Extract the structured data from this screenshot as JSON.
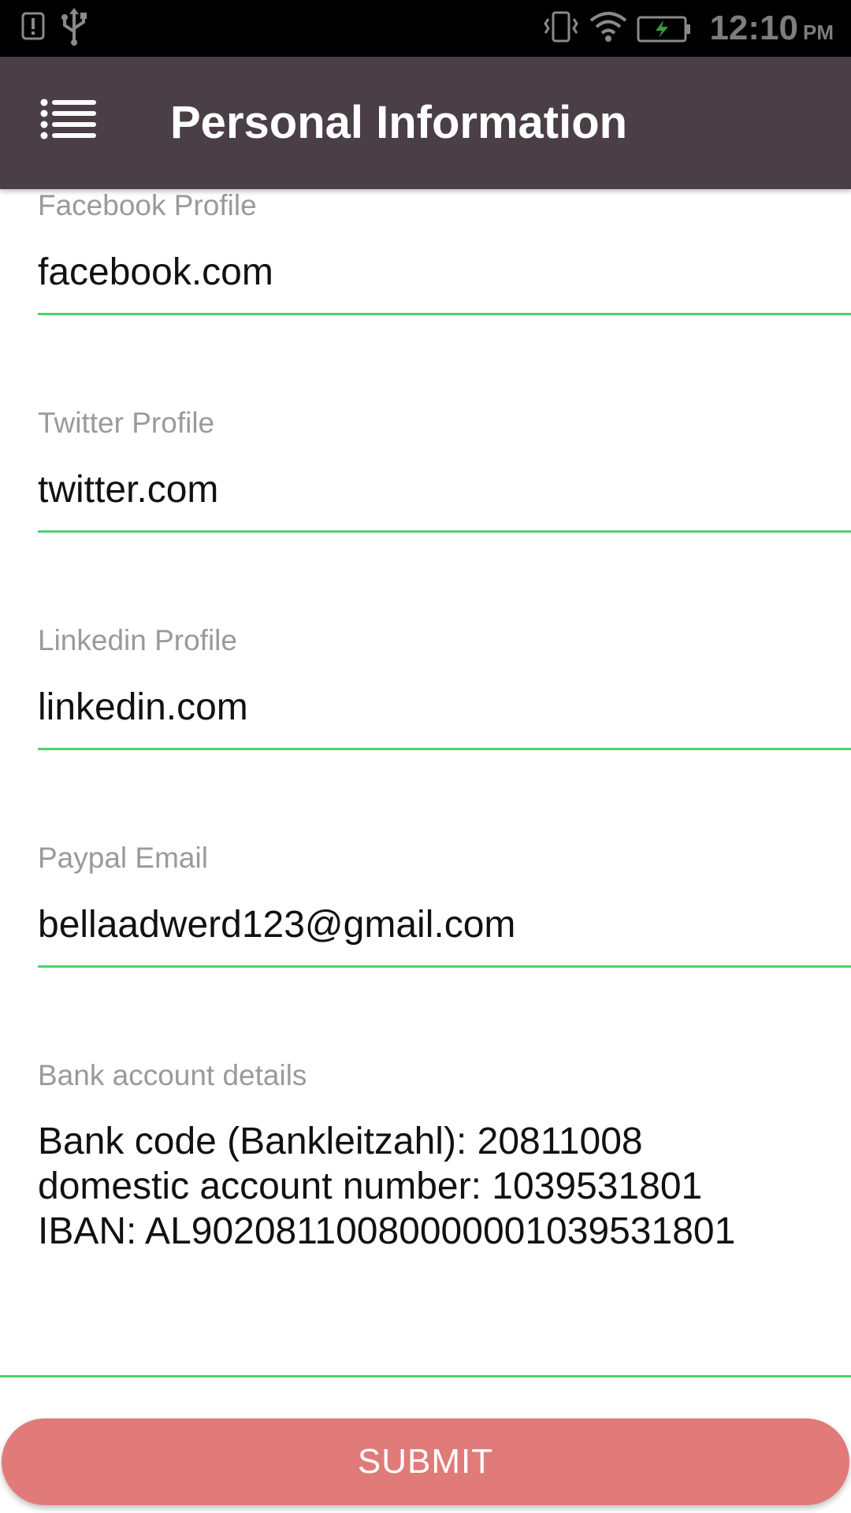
{
  "status_bar": {
    "time": "12:10",
    "ampm": "PM",
    "icons": [
      "alert-icon",
      "usb-icon",
      "vibrate-icon",
      "wifi-icon",
      "battery-charging-icon"
    ]
  },
  "app_bar": {
    "title": "Personal Information",
    "menu_icon": "menu-list-icon"
  },
  "form": {
    "fields": [
      {
        "label": "Facebook Profile",
        "value": "facebook.com"
      },
      {
        "label": "Twitter Profile",
        "value": "twitter.com"
      },
      {
        "label": "Linkedin Profile",
        "value": "linkedin.com"
      },
      {
        "label": "Paypal Email",
        "value": "bellaadwerd123@gmail.com"
      }
    ],
    "bank": {
      "label": "Bank account details",
      "value": "Bank code (Bankleitzahl): 20811008\ndomestic account number: 1039531801\nIBAN: AL90208110080000001039531801"
    }
  },
  "submit": {
    "label": "SUBMIT"
  },
  "colors": {
    "app_bar": "#4a3f47",
    "underline": "#4cd46a",
    "submit": "#e07b7a",
    "label": "#9a9a9a"
  }
}
